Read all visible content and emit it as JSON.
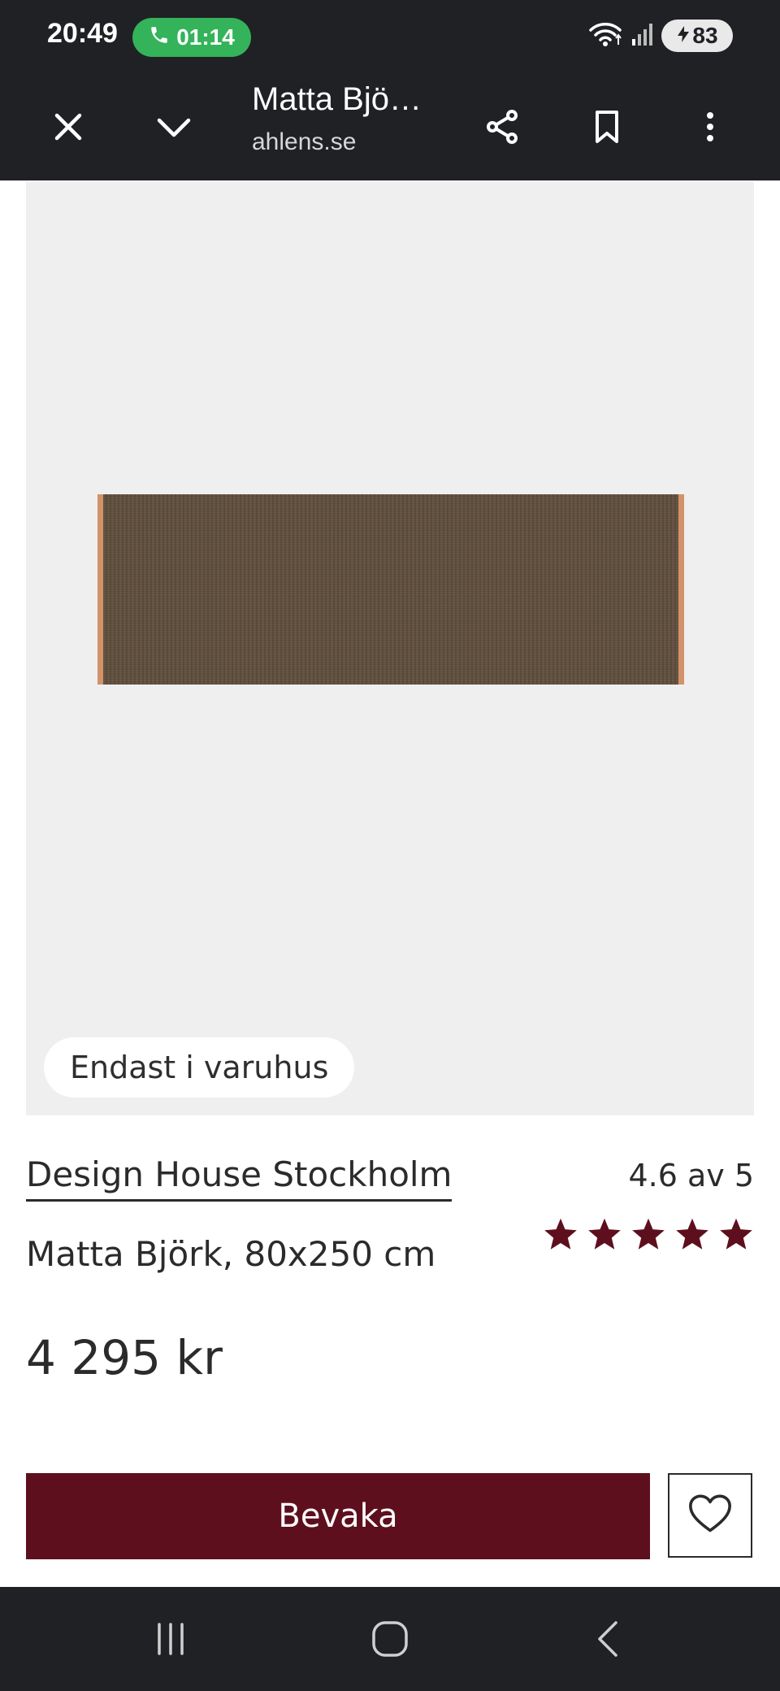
{
  "status_bar": {
    "time": "20:49",
    "call_duration": "01:14",
    "battery": "83",
    "icons": [
      "phone-icon",
      "wifi-icon",
      "signal-icon",
      "battery-icon"
    ]
  },
  "browser": {
    "title": "Matta Bjö…",
    "domain": "ahlens.se",
    "icons": [
      "close-icon",
      "chevron-down-icon",
      "share-icon",
      "bookmark-icon",
      "more-vert-icon"
    ]
  },
  "product": {
    "badge": "Endast i varuhus",
    "brand": "Design House Stockholm",
    "rating_text": "4.6 av 5",
    "rating_value": 4.6,
    "rating_max": 5,
    "name": "Matta Björk, 80x250 cm",
    "price": "4 295 kr",
    "watch_label": "Bevaka",
    "colors": {
      "accent": "#5e0f1e",
      "star": "#5e0f1e"
    }
  },
  "nav_bar": {
    "icons": [
      "recent-apps-icon",
      "home-icon",
      "back-icon"
    ]
  }
}
